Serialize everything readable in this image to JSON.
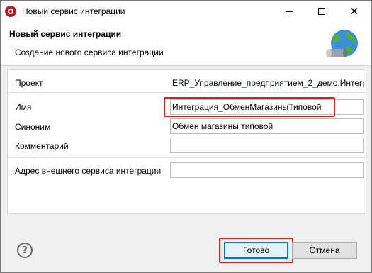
{
  "window": {
    "title": "Новый сервис интеграции"
  },
  "header": {
    "title": "Новый сервис интеграции",
    "description": "Создание нового сервиса интеграции"
  },
  "form": {
    "project_label": "Проект",
    "project_value": "ERP_Управление_предприятием_2_демо.Интегра",
    "name_label": "Имя",
    "name_value": "Интеграция_ОбменМагазиныТиповой",
    "synonym_label": "Синоним",
    "synonym_value": "Обмен магазины типовой",
    "comment_label": "Комментарий",
    "comment_value": "",
    "external_label": "Адрес внешнего сервиса интеграции",
    "external_value": ""
  },
  "buttons": {
    "ok_label": "Готово",
    "cancel_label": "Отмена",
    "help_glyph": "?"
  },
  "colors": {
    "highlight": "#e31b1b",
    "default_button_border": "#0078d7"
  },
  "icons": {
    "app": "1c-app-icon",
    "globe": "globe-integration-icon",
    "help": "help-icon"
  }
}
